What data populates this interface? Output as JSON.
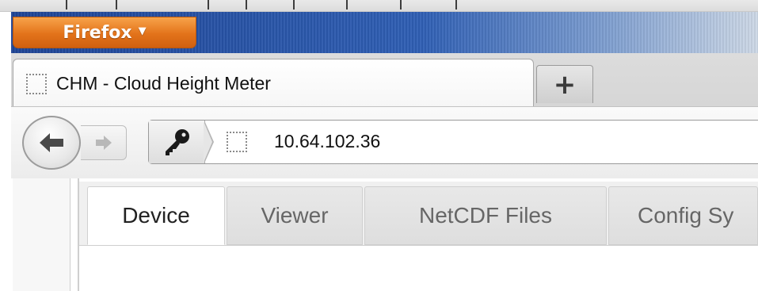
{
  "browser": {
    "menu_button_label": "Firefox",
    "menu_button_caret": "▼",
    "tab": {
      "title": "CHM - Cloud Height Meter"
    },
    "new_tab_label": "+",
    "back_glyph": "🡐",
    "forward_glyph": "➔",
    "url": "10.64.102.36",
    "icons": {
      "identity": "key-icon",
      "site": "page-placeholder-icon"
    }
  },
  "app": {
    "tabs": [
      {
        "label": "Device",
        "active": true
      },
      {
        "label": "Viewer",
        "active": false
      },
      {
        "label": "NetCDF Files",
        "active": false
      },
      {
        "label": "Config Sy",
        "active": false
      }
    ]
  },
  "colors": {
    "firefox_orange": "#e3731a",
    "titlebar_blue": "#2f5fb4"
  }
}
